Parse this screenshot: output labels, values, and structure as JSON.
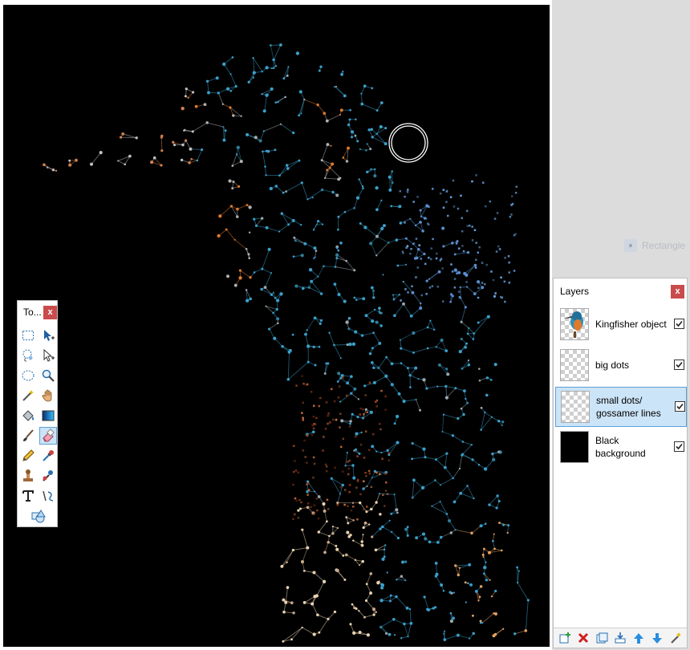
{
  "tools_window": {
    "title": "To...",
    "close_label": "x",
    "tools": [
      {
        "name": "rectangle-select-tool",
        "icon": "dashed-rectangle-icon"
      },
      {
        "name": "move-selected-tool",
        "icon": "arrow-move-icon"
      },
      {
        "name": "lasso-select-tool",
        "icon": "lasso-icon"
      },
      {
        "name": "move-selection-tool",
        "icon": "arrow-move-outline-icon"
      },
      {
        "name": "ellipse-select-tool",
        "icon": "dashed-ellipse-icon"
      },
      {
        "name": "zoom-tool",
        "icon": "magnifier-icon"
      },
      {
        "name": "magic-wand-tool",
        "icon": "magic-wand-icon"
      },
      {
        "name": "pan-tool",
        "icon": "hand-icon"
      },
      {
        "name": "paint-bucket-tool",
        "icon": "paint-bucket-icon"
      },
      {
        "name": "gradient-tool",
        "icon": "gradient-icon"
      },
      {
        "name": "paintbrush-tool",
        "icon": "paintbrush-icon"
      },
      {
        "name": "eraser-tool",
        "icon": "eraser-icon",
        "active": true
      },
      {
        "name": "pencil-tool",
        "icon": "pencil-icon"
      },
      {
        "name": "color-picker-tool",
        "icon": "eyedropper-icon"
      },
      {
        "name": "clone-stamp-tool",
        "icon": "stamp-icon"
      },
      {
        "name": "recolor-tool",
        "icon": "recolor-icon"
      },
      {
        "name": "text-tool",
        "icon": "text-icon"
      },
      {
        "name": "line-curve-tool",
        "icon": "line-curve-icon"
      },
      {
        "name": "shapes-tool",
        "icon": "shapes-icon"
      }
    ]
  },
  "layers_window": {
    "title": "Layers",
    "close_label": "x",
    "layers": [
      {
        "label": "Kingfisher object",
        "visible": true,
        "selected": false,
        "thumb": "kingfisher"
      },
      {
        "label": "big dots",
        "visible": true,
        "selected": false,
        "thumb": "transparent"
      },
      {
        "label": "small dots/ gossamer lines",
        "visible": true,
        "selected": true,
        "thumb": "transparent"
      },
      {
        "label": "Black background",
        "visible": true,
        "selected": false,
        "thumb": "black"
      }
    ],
    "toolbar": [
      {
        "name": "add-layer-button",
        "icon": "add-layer-icon"
      },
      {
        "name": "delete-layer-button",
        "icon": "delete-icon"
      },
      {
        "name": "duplicate-layer-button",
        "icon": "duplicate-icon"
      },
      {
        "name": "merge-layer-down-button",
        "icon": "merge-down-icon"
      },
      {
        "name": "move-layer-up-button",
        "icon": "arrow-up-icon"
      },
      {
        "name": "move-layer-down-button",
        "icon": "arrow-down-icon"
      },
      {
        "name": "layer-properties-button",
        "icon": "properties-icon"
      }
    ]
  },
  "ghost_hint": {
    "label": "Rectangle"
  },
  "colors": {
    "canvas_bg": "#000000",
    "close_red": "#c94c4c",
    "selection_blue": "#cce4f7",
    "selection_border": "#5d9fd8",
    "art_blue": "#3a9fc9",
    "art_orange": "#e07a2a",
    "art_cream": "#e8d2b0"
  }
}
